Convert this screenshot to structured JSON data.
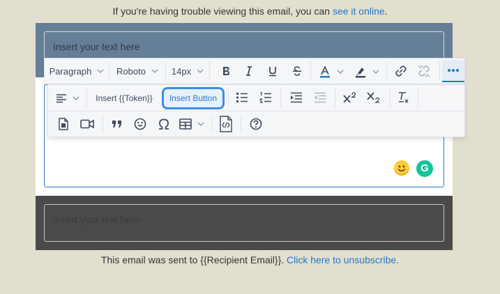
{
  "top_note": {
    "text": "If you're having trouble viewing this email, you can ",
    "link": "see it online",
    "suffix": "."
  },
  "header_placeholder": "Insert your text here",
  "footer_placeholder": "Insert your text here",
  "bottom_note": {
    "text": "This email was sent to {{Recipient Email}}. ",
    "link": "Click here to unsubscribe."
  },
  "toolbar": {
    "paragraph_label": "Paragraph",
    "font_label": "Roboto",
    "size_label": "14px",
    "insert_token_label": "Insert {{Token}}",
    "insert_button_label": "Insert Button"
  },
  "grammarly_label": "G",
  "colors": {
    "header_band": "#667f98",
    "footer_band": "#4a4a4a",
    "accent": "#1e78c8",
    "background": "#e3dfcf"
  }
}
